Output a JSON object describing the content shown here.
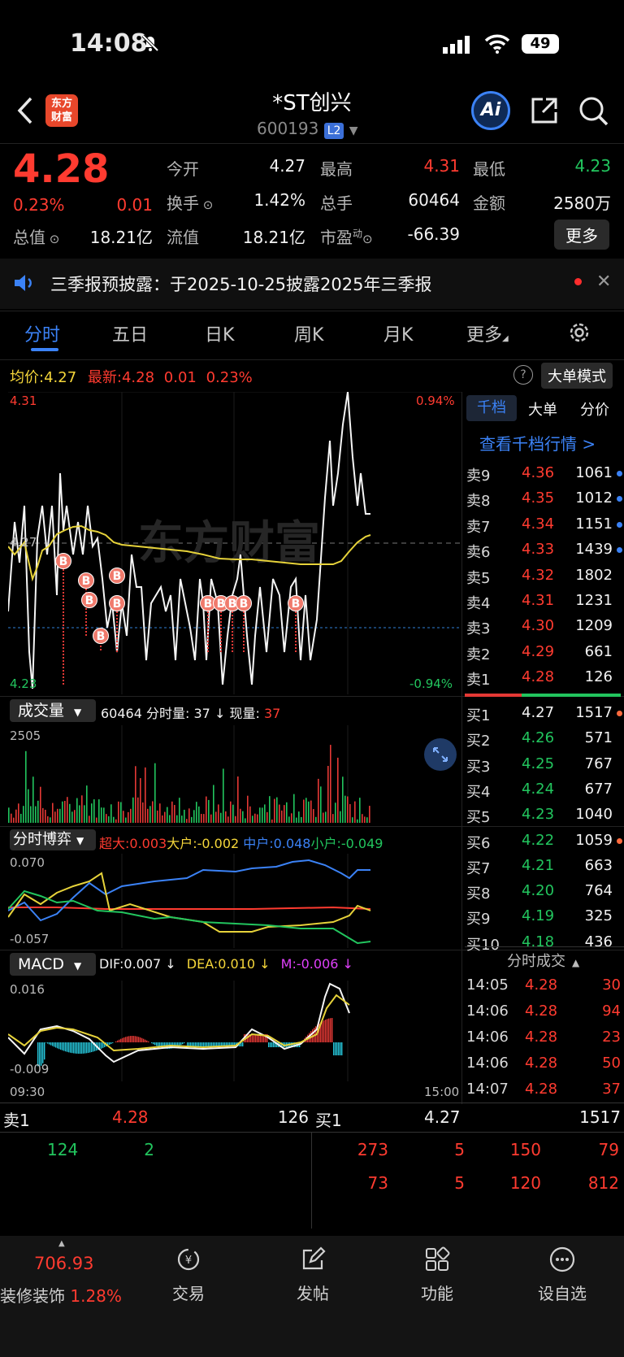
{
  "status_bar": {
    "time": "14:08",
    "battery": "49"
  },
  "header": {
    "logo": "东方\n财富",
    "title": "*ST创兴",
    "code": "600193",
    "level": "L2",
    "ai_label": "Ai"
  },
  "quote": {
    "price": "4.28",
    "pct": "0.23%",
    "change": "0.01",
    "open_lbl": "今开",
    "open": "4.27",
    "high_lbl": "最高",
    "high": "4.31",
    "low_lbl": "最低",
    "low": "4.23",
    "turnover_lbl": "换手",
    "turnover": "1.42%",
    "vol_lbl": "总手",
    "vol": "60464",
    "amount_lbl": "金额",
    "amount": "2580万",
    "mcap_lbl": "总值",
    "mcap": "18.21亿",
    "float_lbl": "流值",
    "float": "18.21亿",
    "pe_lbl": "市盈",
    "pe_sup": "动",
    "pe": "-66.39",
    "more": "更多"
  },
  "notice": {
    "text": "三季报预披露：于2025-10-25披露2025年三季报"
  },
  "tabs": [
    "分时",
    "五日",
    "日K",
    "周K",
    "月K",
    "更多"
  ],
  "avgline": {
    "avg_lbl": "均价:",
    "avg": "4.27",
    "latest_lbl": "最新:",
    "latest": "4.28",
    "chg": "0.01",
    "pct": "0.23%",
    "mode_btn": "大单模式"
  },
  "chart": {
    "y_top": "4.31",
    "y_mid": "4.27",
    "y_bot": "4.23",
    "pct_top": "0.94%",
    "pct_bot": "-0.94%",
    "buy_signal": "B",
    "watermark": "东方财富"
  },
  "volume": {
    "title": "成交量",
    "total": "60464",
    "per_lbl": "分时量:",
    "per": "37",
    "arrow": "↓",
    "now_lbl": "现量:",
    "now": "37",
    "ymax": "2505"
  },
  "bobi": {
    "title": "分时博弈",
    "super": "超大:0.003",
    "big": "大户:-0.002",
    "mid": "中户:0.048",
    "small": "小户:-0.049",
    "ymax": "0.070",
    "ymin": "-0.057"
  },
  "macd": {
    "title": "MACD",
    "dif": "DIF:0.007 ↓",
    "dea": "DEA:0.010 ↓",
    "m": "M:-0.006 ↓",
    "ymax": "0.016",
    "ymin": "-0.009",
    "t_start": "09:30",
    "t_end": "15:00"
  },
  "orderbook": {
    "tabs": [
      "千档",
      "大单",
      "分价"
    ],
    "link": "查看千档行情 >",
    "sells": [
      [
        "卖9",
        "4.36",
        "1061"
      ],
      [
        "卖8",
        "4.35",
        "1012"
      ],
      [
        "卖7",
        "4.34",
        "1151"
      ],
      [
        "卖6",
        "4.33",
        "1439"
      ],
      [
        "卖5",
        "4.32",
        "1802"
      ],
      [
        "卖4",
        "4.31",
        "1231"
      ],
      [
        "卖3",
        "4.30",
        "1209"
      ],
      [
        "卖2",
        "4.29",
        "661"
      ],
      [
        "卖1",
        "4.28",
        "126"
      ]
    ],
    "buys": [
      [
        "买1",
        "4.27",
        "1517"
      ],
      [
        "买2",
        "4.26",
        "571"
      ],
      [
        "买3",
        "4.25",
        "767"
      ],
      [
        "买4",
        "4.24",
        "677"
      ],
      [
        "买5",
        "4.23",
        "1040"
      ],
      [
        "买6",
        "4.22",
        "1059"
      ],
      [
        "买7",
        "4.21",
        "663"
      ],
      [
        "买8",
        "4.20",
        "764"
      ],
      [
        "买9",
        "4.19",
        "325"
      ],
      [
        "买10",
        "4.18",
        "436"
      ]
    ]
  },
  "trades": {
    "title": "分时成交",
    "rows": [
      [
        "14:05",
        "4.28",
        "30"
      ],
      [
        "14:06",
        "4.28",
        "94"
      ],
      [
        "14:06",
        "4.28",
        "23"
      ],
      [
        "14:06",
        "4.28",
        "50"
      ],
      [
        "14:07",
        "4.28",
        "37"
      ]
    ]
  },
  "queue": {
    "sell_lbl": "卖1",
    "sell_price": "4.28",
    "sell_vol": "126",
    "buy_lbl": "买1",
    "buy_price": "4.27",
    "buy_vol": "1517",
    "sell_q": [
      "124",
      "2"
    ],
    "buy_q1": [
      "273",
      "5",
      "150",
      "79"
    ],
    "buy_q2": [
      "73",
      "5",
      "120",
      "812"
    ]
  },
  "bottom": {
    "index_val": "706.93",
    "index_name": "装修装饰",
    "index_pct": "1.28%",
    "trade": "交易",
    "post": "发帖",
    "func": "功能",
    "watch": "设自选"
  },
  "chart_data": {
    "type": "line",
    "title": "",
    "ylim": [
      4.23,
      4.31
    ],
    "x_range": [
      "09:30",
      "15:00"
    ],
    "series": [
      {
        "name": "最新",
        "last": 4.28
      },
      {
        "name": "均价",
        "last": 4.27
      }
    ],
    "volume_ymax": 2505,
    "macd": {
      "dif": 0.007,
      "dea": 0.01,
      "m": -0.006,
      "ylim": [
        -0.009,
        0.016
      ]
    }
  }
}
